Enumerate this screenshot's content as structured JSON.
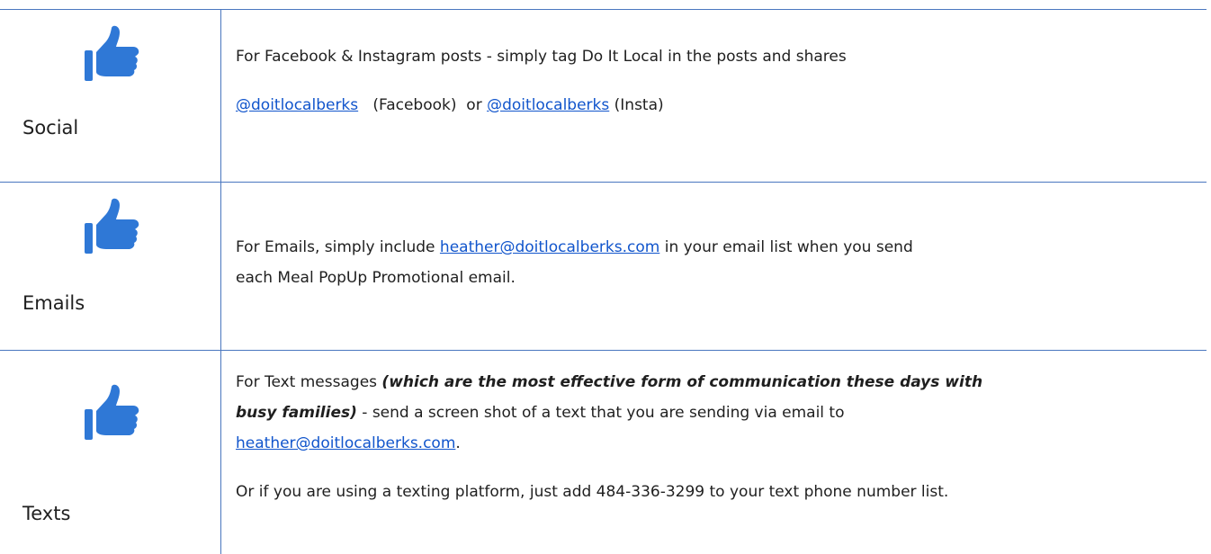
{
  "rows": [
    {
      "label": "Social",
      "icon": "thumbs-up-icon",
      "line1": "For Facebook & Instagram posts - simply tag Do It Local in the posts and shares",
      "fb_handle": "@doitlocalberks",
      "fb_suffix": "(Facebook)  or ",
      "insta_handle": "@doitlocalberks",
      "insta_suffix": " (Insta)"
    },
    {
      "label": "Emails",
      "icon": "thumbs-up-icon",
      "prefix": "For Emails, simply include ",
      "email": "heather@doitlocalberks.com",
      "suffix": " in your email list when you send",
      "line2": "each Meal PopUp Promotional email."
    },
    {
      "label": "Texts",
      "icon": "thumbs-up-icon",
      "prefix": "For Text messages ",
      "emphasis_1": "(which are the most effective form of communication these days with",
      "emphasis_2": "busy families)",
      "middle": " - send a screen shot of a text that you are sending via email to",
      "email": "heather@doitlocalberks.com",
      "email_end": ".",
      "line_last": "Or if you are using a texting platform, just add 484-336-3299 to your text phone number list."
    }
  ],
  "colors": {
    "accent": "#4a77bf",
    "link": "#1155cc",
    "icon": "#2f78d6"
  }
}
